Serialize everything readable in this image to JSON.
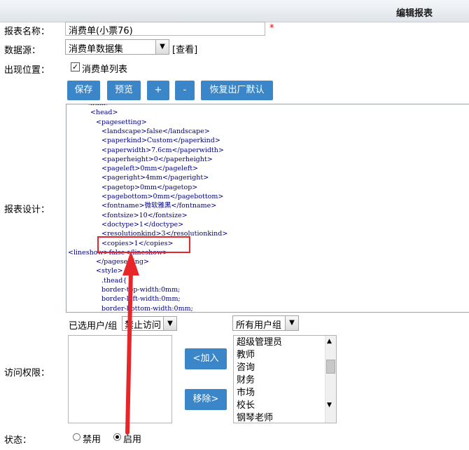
{
  "header": {
    "title": "编辑报表"
  },
  "form": {
    "name_label": "报表名称：",
    "name_value": "消费单(小票76)",
    "required_mark": "*",
    "datasource_label": "数据源：",
    "datasource_value": "消费单数据集",
    "view_link": "[查看]",
    "position_label": "出现位置：",
    "position_checkbox_label": "消费单列表",
    "position_checked": true,
    "design_label": "报表设计：",
    "access_label": "访问权限：",
    "status_label": "状态：",
    "status_options": [
      "禁用",
      "启用"
    ],
    "status_selected": "启用"
  },
  "toolbar": {
    "save": "保存",
    "preview": "预览",
    "plus": "+",
    "minus": "-",
    "reset": "恢复出厂默认"
  },
  "code_lines": [
    {
      "indent": 3,
      "text": "<html>"
    },
    {
      "indent": 4,
      "text": "<head>"
    },
    {
      "indent": 5,
      "text": "<pagesetting>"
    },
    {
      "indent": 6,
      "text": "<landscape>false</landscape>"
    },
    {
      "indent": 6,
      "text": "<paperkind>Custom</paperkind>"
    },
    {
      "indent": 6,
      "text": "<paperwidth>7.6cm</paperwidth>"
    },
    {
      "indent": 6,
      "text": "<paperheight>0</paperheight>"
    },
    {
      "indent": 6,
      "text": "<pageleft>0mm</pageleft>"
    },
    {
      "indent": 6,
      "text": "<pageright>4mm</pageright>"
    },
    {
      "indent": 6,
      "text": "<pagetop>0mm</pagetop>"
    },
    {
      "indent": 6,
      "text": "<pagebottom>0mm</pagebottom>"
    },
    {
      "indent": 6,
      "text": "<fontname>微软雅黑</fontname>"
    },
    {
      "indent": 6,
      "text": "<fontsize>10</fontsize>"
    },
    {
      "indent": 6,
      "text": "<doctype>1</doctype>"
    },
    {
      "indent": 6,
      "text": "<resolutionkind>3</resolutionkind>"
    },
    {
      "indent": 6,
      "text": "<copies>1</copies>"
    },
    {
      "indent": 0,
      "text": "<lineshow>false</lineshow>"
    },
    {
      "indent": 5,
      "text": "</pagesetting>"
    },
    {
      "indent": 5,
      "text": "<style>"
    },
    {
      "indent": 6,
      "text": ".thead{"
    },
    {
      "indent": 6,
      "text": "border-top-width:0mm;"
    },
    {
      "indent": 6,
      "text": "border-left-width:0mm;"
    },
    {
      "indent": 6,
      "text": "border-bottom-width:0mm;"
    }
  ],
  "access": {
    "selected_users_label": "已选用户/组",
    "deny_select": "禁止访问",
    "all_groups_select": "所有用户组",
    "add_button": "<加入",
    "remove_button": "移除>",
    "groups": [
      "超级管理员",
      "教师",
      "咨询",
      "财务",
      "市场",
      "校长",
      "钢琴老师"
    ]
  },
  "annotation": {
    "highlight_color": "#e8262a"
  },
  "colors": {
    "button_blue": "#3a86c8",
    "tag_color": "#000080"
  }
}
